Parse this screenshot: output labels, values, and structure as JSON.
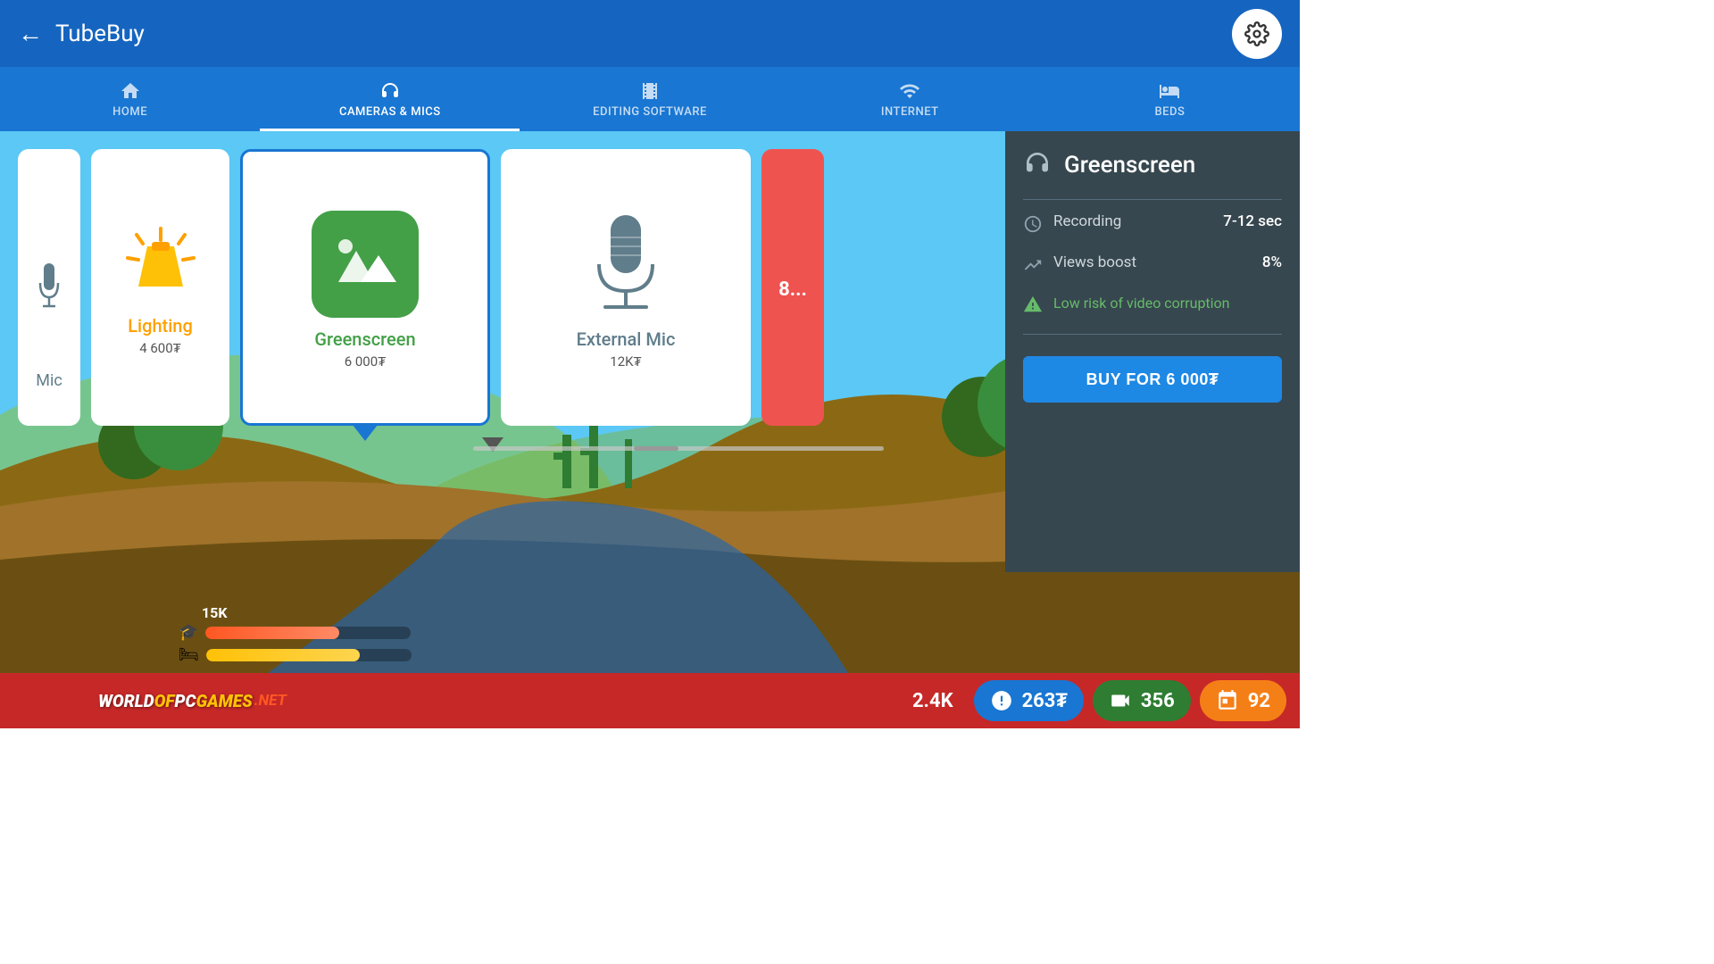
{
  "app": {
    "title": "TubeBuy",
    "back_label": "←"
  },
  "header": {
    "settings_label": "⚙"
  },
  "nav": {
    "tabs": [
      {
        "id": "home",
        "label": "HOME",
        "icon": "home"
      },
      {
        "id": "cameras_mics",
        "label": "CAMERAS & MICS",
        "icon": "headphones",
        "active": true
      },
      {
        "id": "editing_software",
        "label": "EDITING SOFTWARE",
        "icon": "film"
      },
      {
        "id": "internet",
        "label": "INTERNET",
        "icon": "wifi"
      },
      {
        "id": "beds",
        "label": "BEDS",
        "icon": "bed"
      }
    ]
  },
  "cards": [
    {
      "id": "mic",
      "label": "Mic",
      "price": "",
      "color": "#607D8B"
    },
    {
      "id": "lighting",
      "label": "Lighting",
      "price": "4 600₮",
      "color": "#FFA000"
    },
    {
      "id": "greenscreen",
      "label": "Greenscreen",
      "price": "6 000₮",
      "color": "#43A047",
      "selected": true
    },
    {
      "id": "external_mic",
      "label": "External Mic",
      "price": "12K₮",
      "color": "#607D8B"
    },
    {
      "id": "partial",
      "label": "8...",
      "price": "",
      "color": "#EF5350"
    }
  ],
  "detail_panel": {
    "title": "Greenscreen",
    "recording_label": "Recording",
    "recording_value": "7-12 sec",
    "views_boost_label": "Views boost",
    "views_boost_value": "8%",
    "risk_label": "Low risk of video corruption",
    "buy_label": "BUY FOR 6 000₮"
  },
  "status_bar": {
    "site_label": "WORLDOFPCGAMES",
    "site_suffix": ".NET",
    "views_count": "2.4K",
    "currency_count": "263₮",
    "video_count": "356",
    "calendar_count": "92",
    "progress_label": "15K"
  }
}
